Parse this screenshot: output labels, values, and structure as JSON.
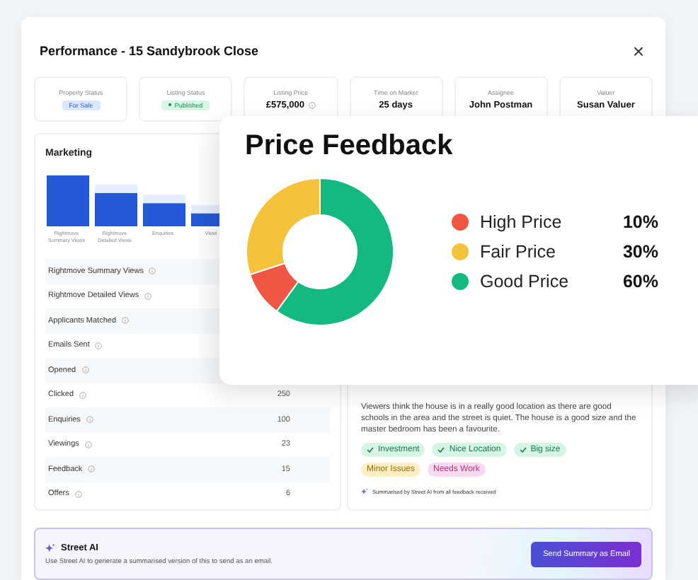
{
  "modal": {
    "title": "Performance - 15 Sandybrook Close",
    "close": "×"
  },
  "stats": [
    {
      "label": "Property Status",
      "value": "For Sale",
      "kind": "tag"
    },
    {
      "label": "Listing Status",
      "value": "Published",
      "kind": "status"
    },
    {
      "label": "Listing Price",
      "value": "£575,000",
      "kind": "price"
    },
    {
      "label": "Time on Market",
      "value": "25 days",
      "kind": "text"
    },
    {
      "label": "Assignee",
      "value": "John Postman",
      "kind": "text"
    },
    {
      "label": "Valuer",
      "value": "Susan Valuer",
      "kind": "text"
    }
  ],
  "marketing": {
    "title": "Marketing",
    "bar_labels": [
      "Rightmove Summary Views",
      "Rightmove Detailed Views",
      "Enquiries",
      "Viewi"
    ],
    "rows": [
      {
        "label": "Rightmove Summary Views"
      },
      {
        "label": "Rightmove Detailed Views"
      },
      {
        "label": "Applicants Matched"
      },
      {
        "label": "Emails Sent"
      },
      {
        "label": "Opened"
      },
      {
        "label": "Clicked",
        "value": "250"
      },
      {
        "label": "Enquiries",
        "value": "100"
      },
      {
        "label": "Viewings",
        "value": "23"
      },
      {
        "label": "Feedback",
        "value": "15"
      },
      {
        "label": "Offers",
        "value": "6"
      }
    ]
  },
  "feedback": {
    "summary": "Viewers think the house is in a really good location as there are good schools in the area and the street is quiet. The house is a good size and the master bedroom has been a favourite.",
    "tags": [
      {
        "label": "Investment",
        "kind": "positive"
      },
      {
        "label": "Nice Location",
        "kind": "positive"
      },
      {
        "label": "Big size",
        "kind": "positive"
      },
      {
        "label": "Minor Issues",
        "kind": "minor"
      },
      {
        "label": "Needs Work",
        "kind": "negative"
      }
    ],
    "note": "Summarised by Street AI from all feedback received"
  },
  "street_ai": {
    "title": "Street AI",
    "description": "Use Street AI to generate a summarised version of this to send as an email.",
    "button": "Send Summary as Email"
  },
  "price_feedback": {
    "legend": [
      {
        "value": "10%",
        "color": "#ef5644"
      },
      {
        "value": "30%",
        "color": "#f5c33b"
      },
      {
        "value": "60%",
        "color": "#13b981"
      }
    ],
    "chart_data": {
      "type": "donut",
      "title": "Price Feedback",
      "categories": [
        "High Price",
        "Fair Price",
        "Good Price"
      ],
      "series": [
        {
          "values": [
            10,
            30,
            60
          ]
        }
      ]
    }
  }
}
